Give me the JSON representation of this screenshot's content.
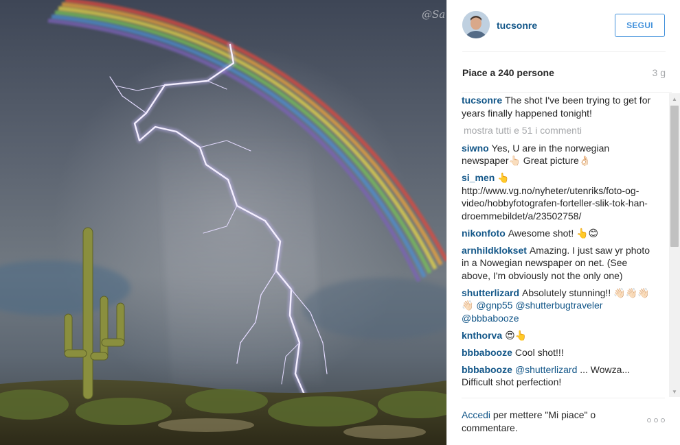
{
  "photo": {
    "watermark": "@Sa"
  },
  "header": {
    "username": "tucsonre",
    "follow_label": "SEGUI"
  },
  "likes": {
    "text": "Piace a 240 persone",
    "age": "3 g"
  },
  "caption": {
    "author": "tucsonre",
    "text": "The shot I've been trying to get for years finally happened tonight!"
  },
  "show_all_comments": "mostra tutti e 51 i commenti",
  "comments": [
    {
      "author": "siwno",
      "text": "Yes, U are in the norwegian newspaper👆🏻 Great picture👌🏻"
    },
    {
      "author": "si_men",
      "text": "👆 http://www.vg.no/nyheter/utenriks/foto-og-video/hobbyfotografen-forteller-slik-tok-han-droemmebildet/a/23502758/"
    },
    {
      "author": "nikonfoto",
      "text": "Awesome shot! 👆😊"
    },
    {
      "author": "arnhildklokset",
      "text": "Amazing. I just saw yr photo in a Nowegian newspaper on net. (See above, I'm obviously not the only one)"
    },
    {
      "author": "shutterlizard",
      "text": "Absolutely stunning!! 👋🏻👋🏻👋🏻👋🏻",
      "mentions": "@gnp55 @shutterbugtraveler @bbbabooze"
    },
    {
      "author": "knthorva",
      "text": "😍👆"
    },
    {
      "author": "bbbabooze",
      "text": "Cool shot!!!"
    },
    {
      "author": "bbbabooze",
      "mentions_first": "@shutterlizard",
      "text": "... Wowza... Difficult shot perfection!"
    }
  ],
  "footer": {
    "login_link": "Accedi",
    "rest": " per mettere \"Mi piace\" o commentare."
  },
  "icons": {
    "more": "more-options-icon",
    "scroll_up": "scroll-up-arrow-icon",
    "scroll_down": "scroll-down-arrow-icon"
  }
}
